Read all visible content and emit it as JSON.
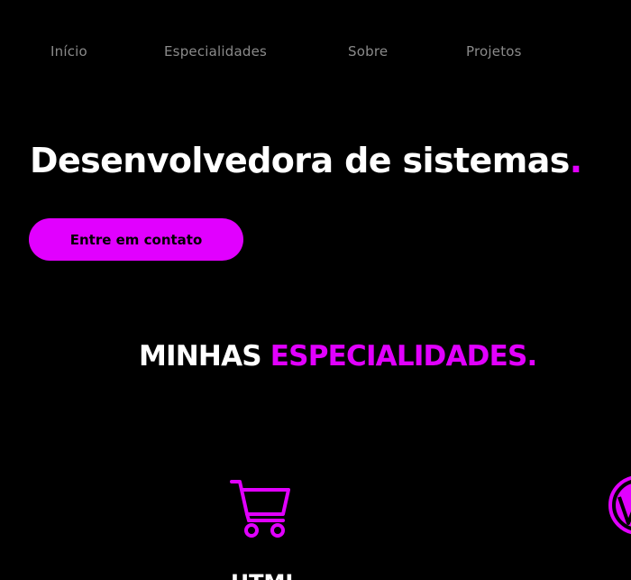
{
  "nav": {
    "items": [
      {
        "label": "Início"
      },
      {
        "label": "Especialidades"
      },
      {
        "label": "Sobre"
      },
      {
        "label": "Projetos"
      }
    ]
  },
  "hero": {
    "title": "Desenvolvedora de sistemas",
    "title_dot": ".",
    "cta_label": "Entre em contato"
  },
  "specialties": {
    "title_white": "MINHAS",
    "title_accent": "ESPECIALIDADES.",
    "cards": [
      {
        "icon": "shopping-cart-icon",
        "label": "HTML"
      },
      {
        "icon": "wordpress-icon",
        "label": ""
      }
    ]
  },
  "colors": {
    "background": "#000000",
    "accent": "#e100ff",
    "text": "#ffffff",
    "nav_text": "#8a8a8a"
  }
}
